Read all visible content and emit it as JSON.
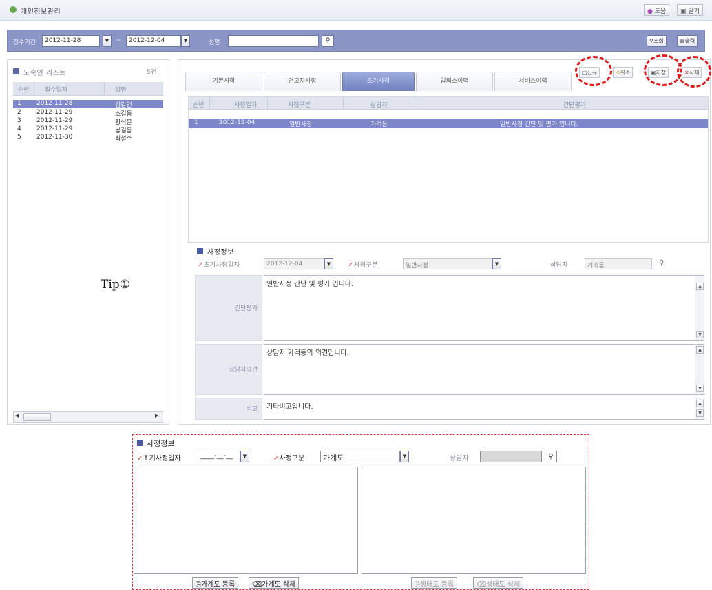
{
  "window": {
    "title": "개인정보관리",
    "help_label": "도움",
    "close_label": "닫기"
  },
  "search": {
    "period_label": "접수기간",
    "date_from": "2012-11-28",
    "date_sep": "~",
    "date_to": "2012-12-04",
    "name_label": "성명",
    "name_value": "",
    "query_label": "조회",
    "print_label": "출력"
  },
  "left": {
    "title": "노숙인 리스트",
    "count": "5건",
    "columns": [
      "순번",
      "접수일자",
      "성명"
    ],
    "rows": [
      {
        "no": "1",
        "date": "2012-11-28",
        "name": "김갑인"
      },
      {
        "no": "2",
        "date": "2012-11-29",
        "name": "소길동"
      },
      {
        "no": "3",
        "date": "2012-11-29",
        "name": "황식분"
      },
      {
        "no": "4",
        "date": "2012-11-29",
        "name": "봉길동"
      },
      {
        "no": "5",
        "date": "2012-11-30",
        "name": "최철수"
      }
    ]
  },
  "tabs": [
    "기본사항",
    "연고자사항",
    "초기사정",
    "입퇴소이력",
    "서비스이력"
  ],
  "active_tab": "초기사정",
  "actions": {
    "new_label": "신규",
    "cancel_label": "취소",
    "save_label": "저장",
    "delete_label": "삭제"
  },
  "grid": {
    "columns": [
      "순번",
      "사정일자",
      "사정구분",
      "상담자",
      "간단평가"
    ],
    "rows": [
      {
        "no": "1",
        "date": "2012-12-04",
        "type": "일반사정",
        "counselor": "가걱동",
        "summary": "일반사정 간단 및 평가 입니다."
      }
    ]
  },
  "assessment": {
    "section_title": "사정정보",
    "initial_date_label": "초기사정일자",
    "initial_date_value": "2012-12-04",
    "type_label": "사정구분",
    "type_value": "일반사정",
    "counselor_label": "상담자",
    "counselor_value": "가걱동",
    "summary_label": "간단평가",
    "summary_value": "일반사정 간단 및 평가 입니다.",
    "opinion_label": "상담자의견",
    "opinion_value": "상담자 가걱동의 의견입니다.",
    "note_label": "비고",
    "note_value": "기타비고입니다."
  },
  "tip": "Tip①",
  "detail": {
    "section_title": "사정정보",
    "initial_date_label": "초기사정일자",
    "initial_date_value": "____-__-__",
    "type_label": "사정구분",
    "type_value": "가계도",
    "counselor_label": "상담자",
    "counselor_value": "",
    "genogram_add": "가계도 등록",
    "genogram_delete": "가계도 삭제",
    "ecomap_add": "생태도 등록",
    "ecomap_delete": "생태도 삭제"
  },
  "colors": {
    "accent": "#8c96c6",
    "selection": "#7d86c8",
    "highlight": "#e01a1a"
  }
}
